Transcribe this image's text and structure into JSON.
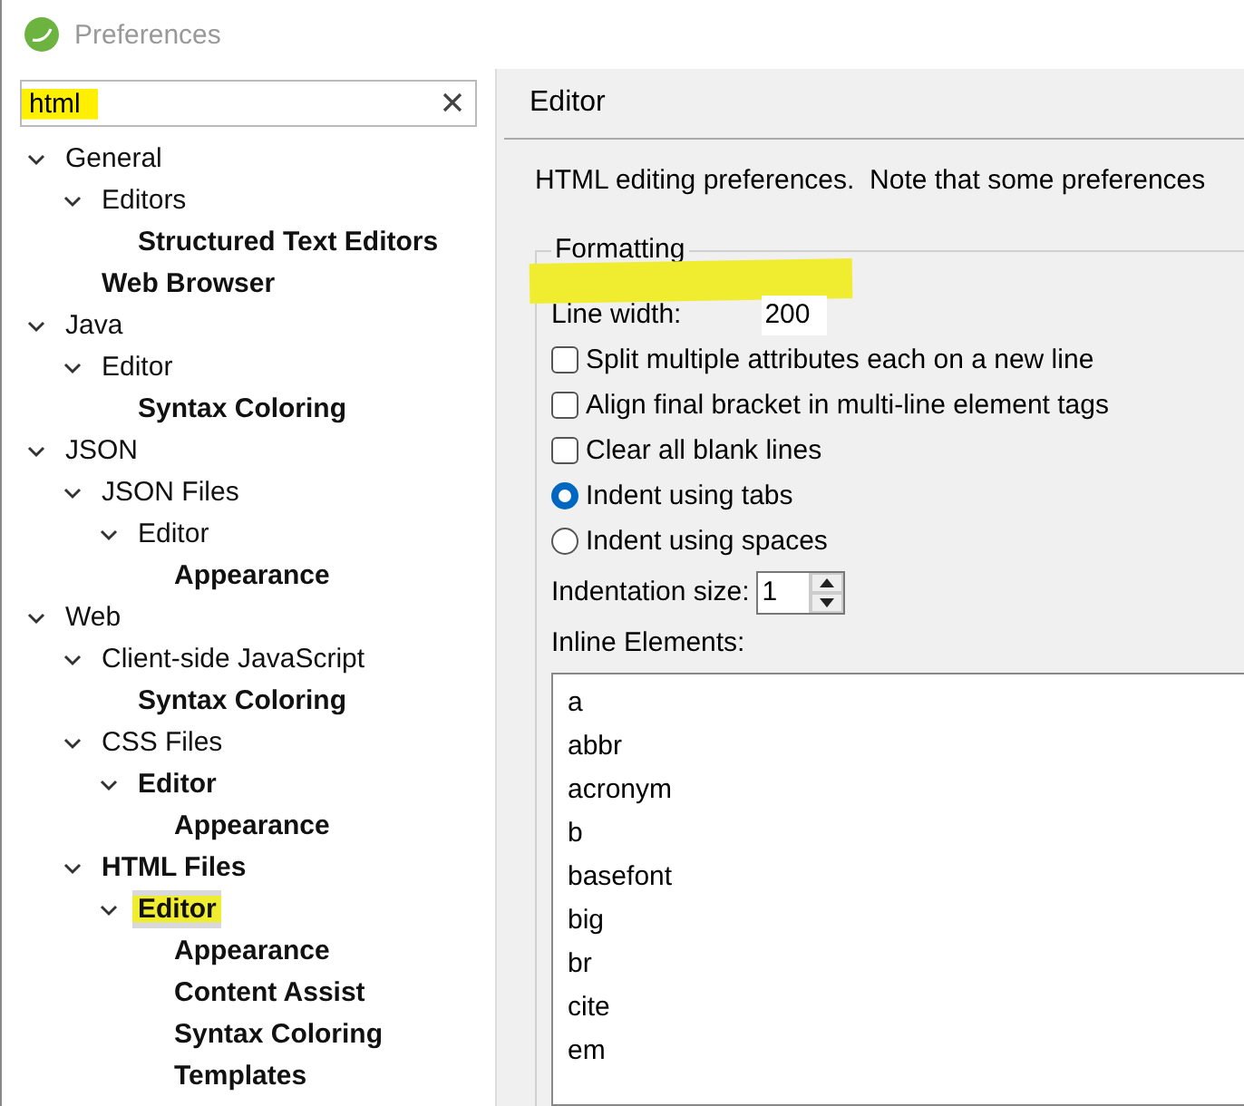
{
  "window": {
    "title": "Preferences"
  },
  "search": {
    "value": "html",
    "highlighted": true
  },
  "tree": [
    {
      "label": "General",
      "bold": false,
      "expanded": true,
      "selected": false,
      "highlighted": false,
      "children": [
        {
          "label": "Editors",
          "bold": false,
          "expanded": true,
          "selected": false,
          "highlighted": false,
          "children": [
            {
              "label": "Structured Text Editors",
              "bold": true,
              "selected": false,
              "highlighted": false
            }
          ]
        },
        {
          "label": "Web Browser",
          "bold": true,
          "selected": false,
          "highlighted": false
        }
      ]
    },
    {
      "label": "Java",
      "bold": false,
      "expanded": true,
      "selected": false,
      "highlighted": false,
      "children": [
        {
          "label": "Editor",
          "bold": false,
          "expanded": true,
          "selected": false,
          "highlighted": false,
          "children": [
            {
              "label": "Syntax Coloring",
              "bold": true,
              "selected": false,
              "highlighted": false
            }
          ]
        }
      ]
    },
    {
      "label": "JSON",
      "bold": false,
      "expanded": true,
      "selected": false,
      "highlighted": false,
      "children": [
        {
          "label": "JSON Files",
          "bold": false,
          "expanded": true,
          "selected": false,
          "highlighted": false,
          "children": [
            {
              "label": "Editor",
              "bold": false,
              "expanded": true,
              "selected": false,
              "highlighted": false,
              "children": [
                {
                  "label": "Appearance",
                  "bold": true,
                  "selected": false,
                  "highlighted": false
                }
              ]
            }
          ]
        }
      ]
    },
    {
      "label": "Web",
      "bold": false,
      "expanded": true,
      "selected": false,
      "highlighted": false,
      "children": [
        {
          "label": "Client-side JavaScript",
          "bold": false,
          "expanded": true,
          "selected": false,
          "highlighted": false,
          "children": [
            {
              "label": "Syntax Coloring",
              "bold": true,
              "selected": false,
              "highlighted": false
            }
          ]
        },
        {
          "label": "CSS Files",
          "bold": false,
          "expanded": true,
          "selected": false,
          "highlighted": false,
          "children": [
            {
              "label": "Editor",
              "bold": true,
              "expanded": true,
              "selected": false,
              "highlighted": false,
              "children": [
                {
                  "label": "Appearance",
                  "bold": true,
                  "selected": false,
                  "highlighted": false
                }
              ]
            }
          ]
        },
        {
          "label": "HTML Files",
          "bold": true,
          "expanded": true,
          "selected": false,
          "highlighted": false,
          "children": [
            {
              "label": "Editor",
              "bold": true,
              "expanded": true,
              "selected": true,
              "highlighted": true,
              "children": [
                {
                  "label": "Appearance",
                  "bold": true,
                  "selected": false,
                  "highlighted": false
                },
                {
                  "label": "Content Assist",
                  "bold": true,
                  "selected": false,
                  "highlighted": false
                },
                {
                  "label": "Syntax Coloring",
                  "bold": true,
                  "selected": false,
                  "highlighted": false
                },
                {
                  "label": "Templates",
                  "bold": true,
                  "selected": false,
                  "highlighted": false
                }
              ]
            }
          ]
        }
      ]
    }
  ],
  "page": {
    "title": "Editor",
    "description": "HTML editing preferences.  Note that some preferences",
    "group": {
      "title": "Formatting",
      "line_width": {
        "label": "Line width:",
        "value": "200",
        "highlighted": true
      },
      "options": [
        {
          "kind": "checkbox",
          "label": "Split multiple attributes each on a new line",
          "checked": false
        },
        {
          "kind": "checkbox",
          "label": "Align final bracket in multi-line element tags",
          "checked": false
        },
        {
          "kind": "checkbox",
          "label": "Clear all blank lines",
          "checked": false
        },
        {
          "kind": "radio",
          "label": "Indent using tabs",
          "checked": true
        },
        {
          "kind": "radio",
          "label": "Indent using spaces",
          "checked": false
        }
      ],
      "indentation": {
        "label": "Indentation size:",
        "value": "1"
      },
      "inline_elements": {
        "label": "Inline Elements:",
        "items": [
          "a",
          "abbr",
          "acronym",
          "b",
          "basefont",
          "big",
          "br",
          "cite",
          "em"
        ]
      }
    }
  }
}
